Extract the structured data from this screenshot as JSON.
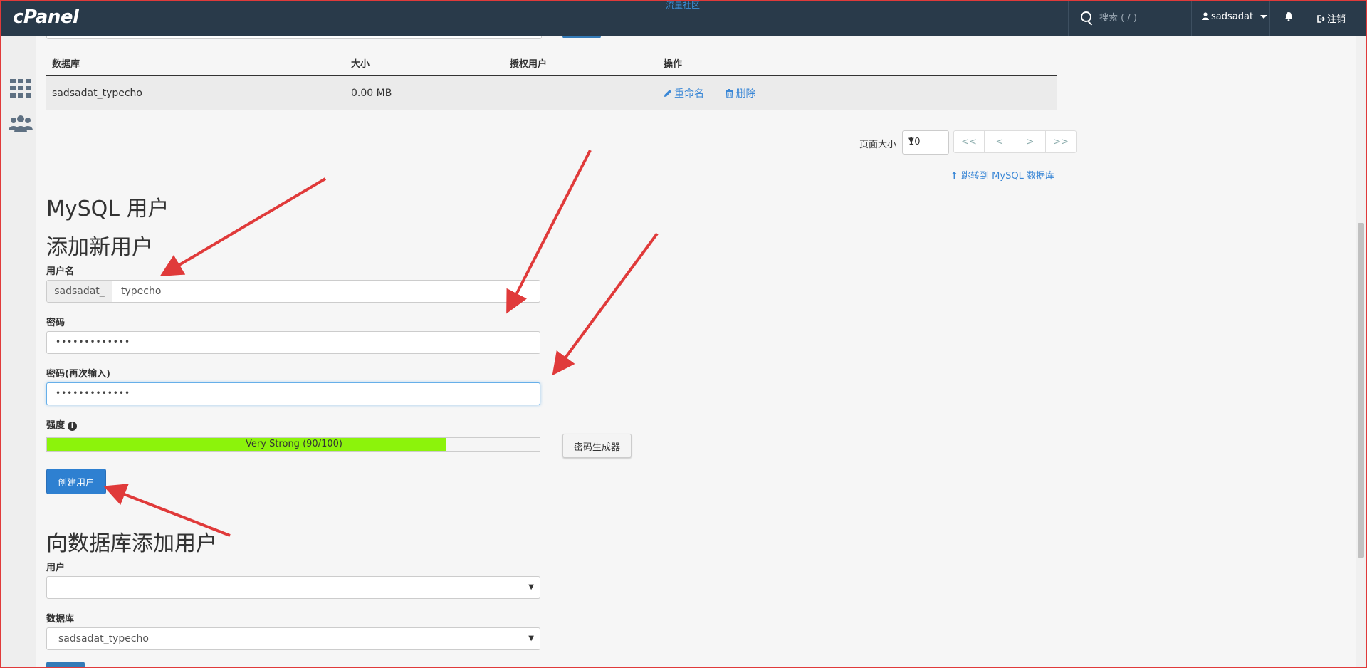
{
  "topbar": {
    "logo": "cPanel",
    "note": "流量社区",
    "search_placeholder": "搜索 ( / )",
    "username": "sadsadat",
    "logout": "注销"
  },
  "databases_table": {
    "headers": [
      "数据库",
      "大小",
      "授权用户",
      "操作"
    ],
    "rows": [
      {
        "name": "sadsadat_typecho",
        "size": "0.00 MB",
        "users": "",
        "rename": "重命名",
        "delete": "删除"
      }
    ]
  },
  "pagination": {
    "page_size_label": "页面大小",
    "page_size": "10",
    "buttons": [
      "<<",
      "<",
      ">",
      ">>"
    ],
    "jump_link": "跳转到 MySQL 数据库"
  },
  "mysql_users": {
    "title": "MySQL 用户",
    "add_title": "添加新用户",
    "username_label": "用户名",
    "username_prefix": "sadsadat_",
    "username_value": "typecho",
    "password_label": "密码",
    "password_value": "•••••••••••••",
    "password2_label": "密码(再次输入)",
    "password2_value": "•••••••••••••",
    "strength_label": "强度",
    "strength_text": "Very Strong (90/100)",
    "strength_value": 90,
    "generator_button": "密码生成器",
    "create_button": "创建用户"
  },
  "add_to_db": {
    "title": "向数据库添加用户",
    "user_label": "用户",
    "user_value": "",
    "db_label": "数据库",
    "db_value": "sadsadat_typecho"
  },
  "colors": {
    "topbar": "#293a4a",
    "link": "#3a87d6",
    "primary": "#2e80d1",
    "strength_fill": "#8cf30b",
    "annotation_arrow": "#e03a3a"
  }
}
